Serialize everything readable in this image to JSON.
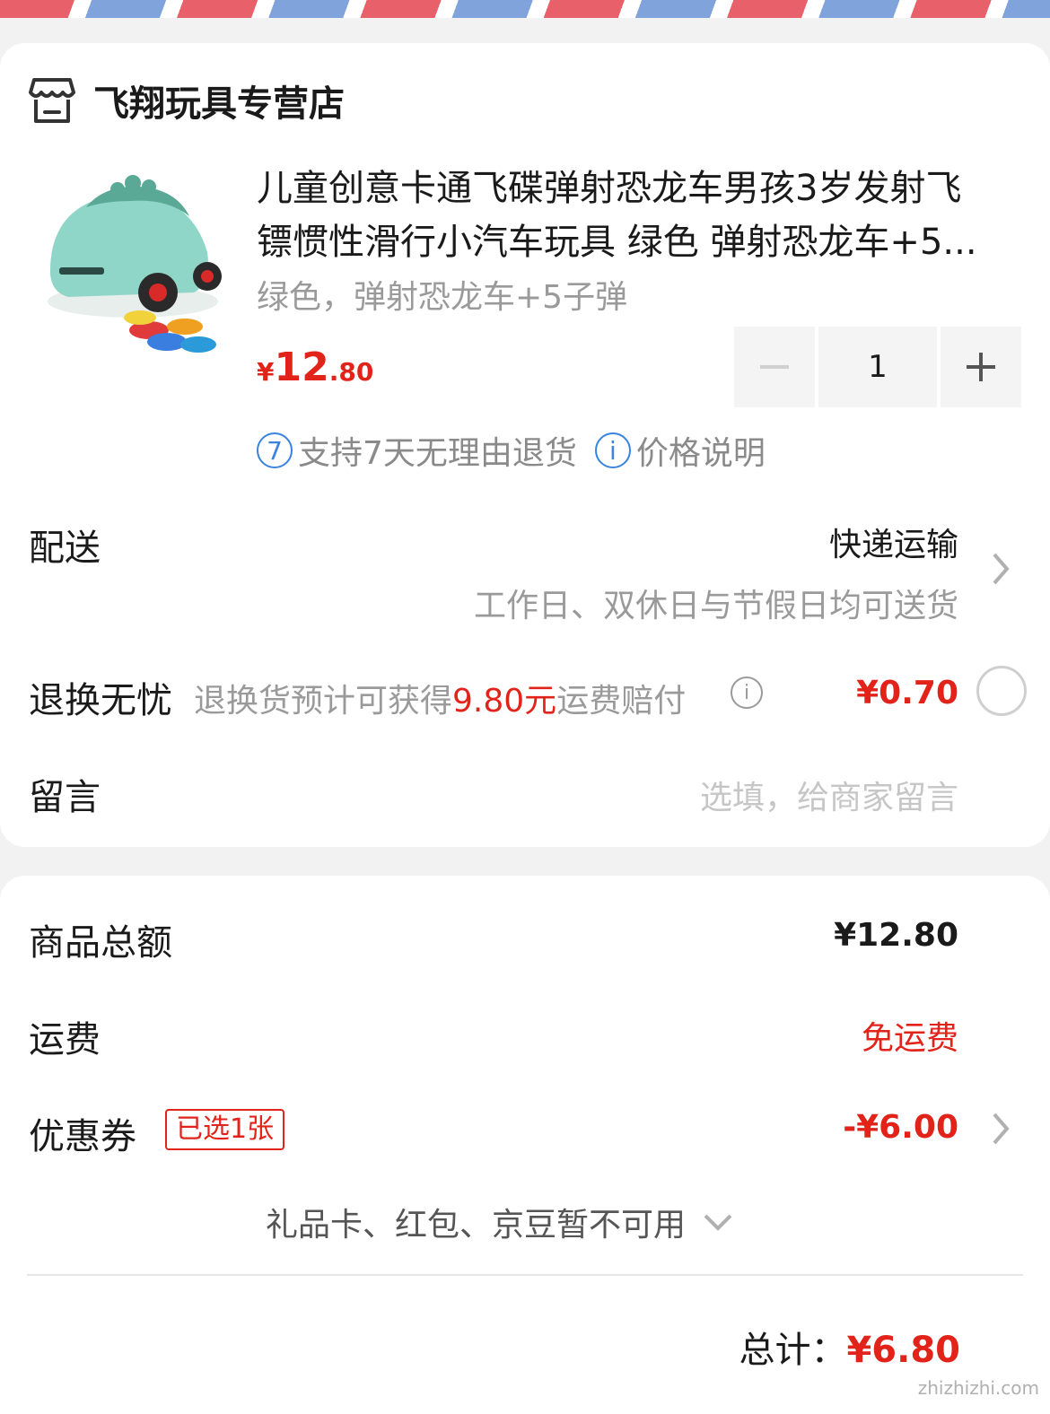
{
  "colors": {
    "accent_red": "#e2231a",
    "link_blue": "#3a84e0",
    "muted": "#9a9a9a",
    "stripe_red": "#e8606a",
    "stripe_blue": "#7fa3da"
  },
  "store": {
    "icon": "store-icon",
    "name": "飞翔玩具专营店"
  },
  "product": {
    "title_line1": "儿童创意卡通飞碟弹射恐龙车男孩3岁发射飞",
    "title_line2": "镖惯性滑行小汽车玩具 绿色 弹射恐龙车+5...",
    "sku": "绿色，弹射恐龙车+5子弹",
    "price_yen": "¥",
    "price_int": "12",
    "price_dec": ".80",
    "quantity": "1",
    "tag_return_badge": "7",
    "tag_return": "支持7天无理由退货",
    "tag_price_badge": "i",
    "tag_price": "价格说明"
  },
  "shipping": {
    "label": "配送",
    "method": "快递运输",
    "note": "工作日、双休日与节假日均可送货"
  },
  "return_worry": {
    "label": "退换无忧",
    "desc_pre": "退换货预计可获得",
    "desc_amount": "9.80元",
    "desc_post": "运费赔付",
    "info_icon": "i",
    "price": "¥0.70"
  },
  "message": {
    "label": "留言",
    "placeholder": "选填，给商家留言"
  },
  "summary": {
    "goods_label": "商品总额",
    "goods_value": "¥12.80",
    "freight_label": "运费",
    "freight_value": "免运费",
    "coupon_label": "优惠券",
    "coupon_badge": "已选1张",
    "coupon_value": "-¥6.00",
    "unavailable": "礼品卡、红包、京豆暂不可用",
    "total_label": "总计：",
    "total_value": "¥6.80"
  },
  "watermark": "zhizhizhi.com"
}
